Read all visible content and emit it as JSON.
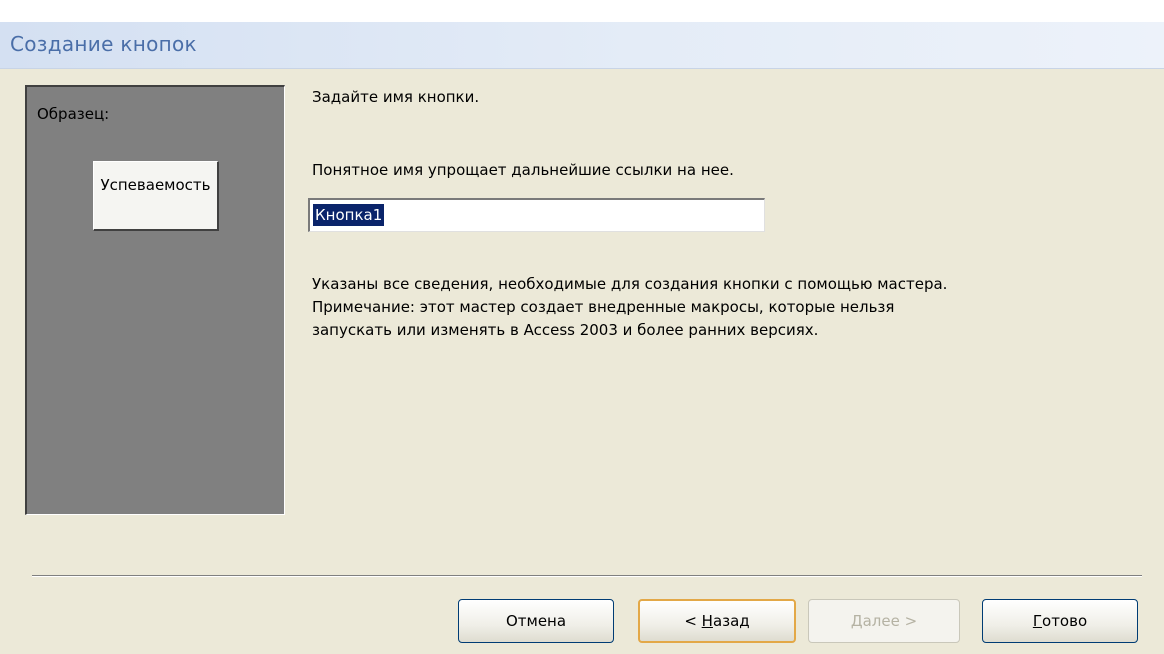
{
  "window": {
    "title": "Создание кнопок"
  },
  "preview": {
    "label": "Образец:",
    "button_caption": "Успеваемость"
  },
  "form": {
    "heading": "Задайте имя кнопки.",
    "hint": "Понятное имя упрощает дальнейшие ссылки на нее.",
    "name_value": "Кнопка1",
    "info_line1": "Указаны все сведения, необходимые для создания кнопки с помощью мастера.",
    "info_line2": "Примечание: этот мастер создает внедренные макросы, которые нельзя",
    "info_line3": "запускать или изменять в Access 2003 и более ранних версиях."
  },
  "buttons": {
    "cancel": "Отмена",
    "back_prefix": "< ",
    "back_accel": "Н",
    "back_rest": "азад",
    "next_accel": "Д",
    "next_rest": "алее >",
    "finish_accel": "Г",
    "finish_rest": "отово"
  },
  "colors": {
    "title_text": "#4a6ea8",
    "dialog_bg": "#ece9d8",
    "preview_bg": "#808080",
    "selection": "#0a246a",
    "focus_border": "#e3a847"
  }
}
